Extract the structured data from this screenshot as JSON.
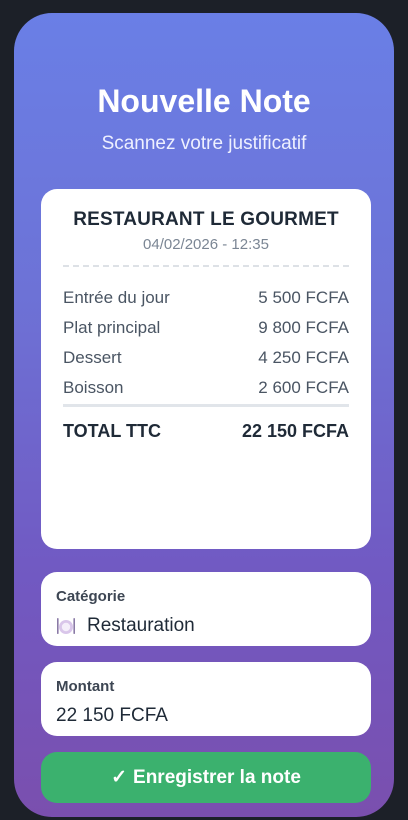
{
  "header": {
    "title": "Nouvelle Note",
    "subtitle": "Scannez votre justificatif"
  },
  "receipt": {
    "restaurant": "RESTAURANT LE GOURMET",
    "datetime": "04/02/2026 - 12:35",
    "items": [
      {
        "label": "Entrée du jour",
        "amount": "5 500 FCFA"
      },
      {
        "label": "Plat principal",
        "amount": "9 800 FCFA"
      },
      {
        "label": "Dessert",
        "amount": "4 250 FCFA"
      },
      {
        "label": "Boisson",
        "amount": "2 600 FCFA"
      }
    ],
    "total_label": "TOTAL TTC",
    "total_amount": "22 150 FCFA"
  },
  "category": {
    "label": "Catégorie",
    "value": "Restauration",
    "icon": "plate-cutlery-icon"
  },
  "amount": {
    "label": "Montant",
    "value": "22 150 FCFA"
  },
  "save_button": {
    "icon": "✓",
    "label": "Enregistrer la note"
  },
  "colors": {
    "gradient_top": "#6a7fe6",
    "gradient_bottom": "#7a4fae",
    "button": "#3bb16e"
  }
}
